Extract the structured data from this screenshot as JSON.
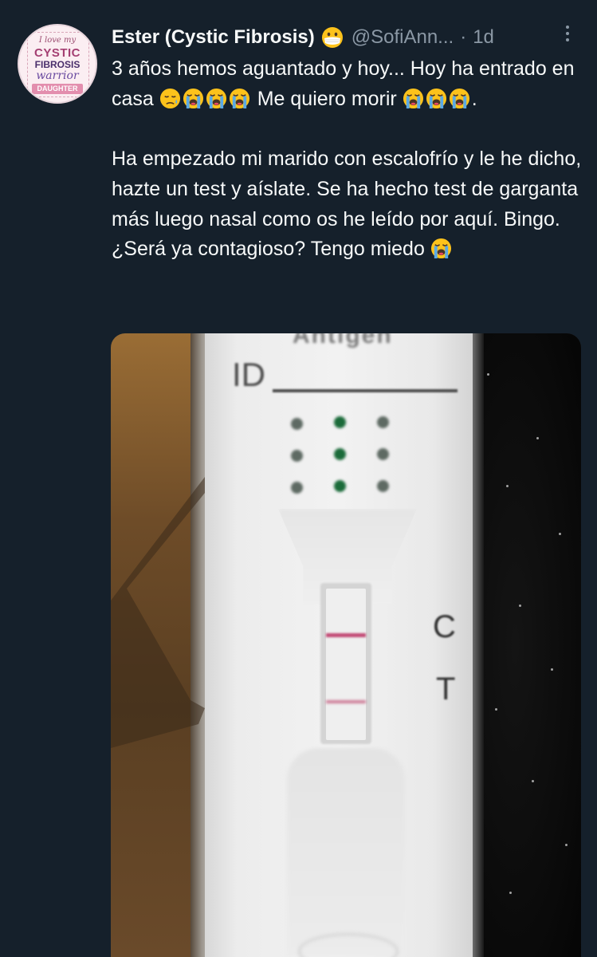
{
  "tweet": {
    "display_name": "Ester (Cystic Fibrosis)",
    "name_emoji": "mask-face-emoji",
    "handle": "@SofiAnn...",
    "separator": "·",
    "time": "1d",
    "more_icon": "more-vertical-icon",
    "avatar": {
      "line1": "I love my",
      "line2": "CYSTIC",
      "line3": "FIBROSIS",
      "line4": "warrior",
      "line5": "DAUGHTER"
    },
    "text": {
      "p1_a": "3 años hemos aguantado y hoy... Hoy ha entrado en casa ",
      "p1_b": " Me quiero morir ",
      "p1_c": ".",
      "p2": "Ha empezado mi marido con escalofrío y le he dicho, hazte un test y aíslate. Se ha hecho test de garganta más luego nasal como os he leído por aquí. Bingo. ¿Será ya contagioso? Tengo miedo "
    },
    "media": {
      "alt": "antigen-test-photo",
      "id_label": "ID",
      "c_label": "C",
      "t_label": "T",
      "antigen_label": "Antigen"
    }
  },
  "colors": {
    "background": "#15202b",
    "primary_text": "#f7f9f9",
    "secondary_text": "#8b98a5",
    "line_color": "#c24b75"
  }
}
